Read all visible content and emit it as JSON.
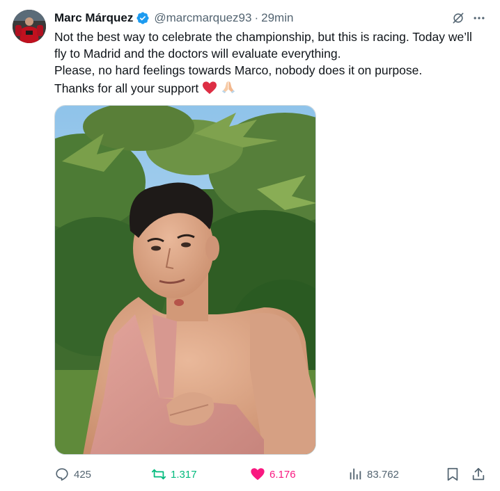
{
  "author": {
    "name": "Marc Márquez",
    "handle": "@marcmarquez93",
    "separator": "·",
    "time": "29min",
    "verified_color": "#1d9bf0"
  },
  "icons": {
    "verified": "verified-badge-icon",
    "grok": "grok-icon",
    "more": "more-icon",
    "reply": "reply-icon",
    "retweet": "retweet-icon",
    "like": "like-icon",
    "views": "views-icon",
    "bookmark": "bookmark-icon",
    "share": "share-icon",
    "heart_emoji": "red-heart-emoji",
    "pray_emoji": "folded-hands-emoji"
  },
  "tweet": {
    "line1": "Not the best way to celebrate the championship, but this is racing. Today we’ll fly to Madrid and the doctors will evaluate everything.",
    "line2": "Please, no hard feelings towards Marco, nobody does it on purpose.",
    "line3": "Thanks for all your support"
  },
  "metrics": {
    "replies": "425",
    "retweets": "1.317",
    "likes": "6.176",
    "views": "83.762"
  },
  "colors": {
    "text": "#0f1419",
    "muted": "#536471",
    "retweet": "#00ba7c",
    "like": "#f91880",
    "link": "#1d9bf0"
  }
}
